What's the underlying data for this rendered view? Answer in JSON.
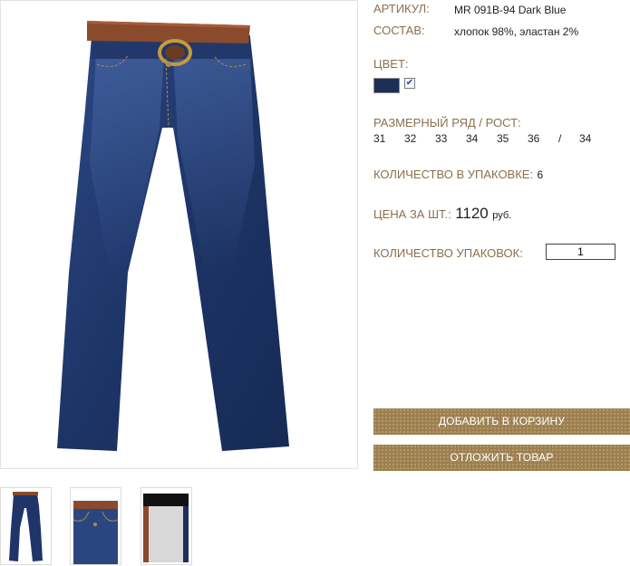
{
  "product": {
    "article_label": "АРТИКУЛ:",
    "article_value": "MR 091B-94 Dark Blue",
    "composition_label": "СОСТАВ:",
    "composition_value": "хлопок 98%, эластан 2%",
    "color_label": "ЦВЕТ:",
    "size_label": "РАЗМЕРНЫЙ РЯД / РОСТ:",
    "sizes": [
      "31",
      "32",
      "33",
      "34",
      "35",
      "36",
      "/",
      "34"
    ],
    "pack_count_label": "КОЛИЧЕСТВО В УПАКОВКЕ:",
    "pack_count_value": "6",
    "price_label": "ЦЕНА ЗА ШТ.:",
    "price_value": "1120",
    "price_unit": "руб.",
    "packs_label": "КОЛИЧЕСТВО УПАКОВОК:",
    "packs_value": "1"
  },
  "buttons": {
    "add_to_cart": "ДОБАВИТЬ В КОРЗИНУ",
    "defer": "ОТЛОЖИТЬ ТОВАР"
  },
  "colors": {
    "label_text": "#8b6f4e",
    "button_bg": "#9b7f52",
    "swatch": "#1d2f56"
  }
}
